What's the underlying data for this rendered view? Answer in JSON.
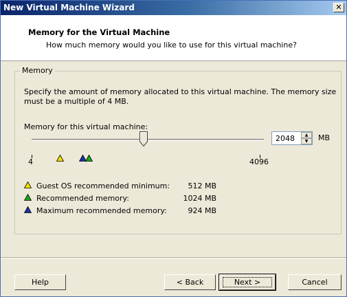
{
  "window": {
    "title": "New Virtual Machine Wizard",
    "close_glyph": "✕"
  },
  "header": {
    "title": "Memory for the Virtual Machine",
    "subtitle": "How much memory would you like to use for this virtual machine?"
  },
  "memory_group": {
    "label": "Memory",
    "description": "Specify the amount of memory allocated to this virtual machine. The memory size must be a multiple of 4 MB.",
    "field_label": "Memory for this virtual machine:",
    "slider": {
      "min_label": "4",
      "max_label": "4096",
      "current_mb": 2048
    },
    "spin_value": "2048",
    "unit": "MB",
    "legend": [
      {
        "icon": "yellow-triangle-icon",
        "color": "#f5e000",
        "label": "Guest OS recommended minimum:",
        "value": "512 MB"
      },
      {
        "icon": "green-triangle-icon",
        "color": "#1aa81a",
        "label": "Recommended memory:",
        "value": "1024 MB"
      },
      {
        "icon": "blue-triangle-icon",
        "color": "#1f2fa8",
        "label": "Maximum recommended memory:",
        "value": "924 MB"
      }
    ]
  },
  "buttons": {
    "help": "Help",
    "back": "< Back",
    "next": "Next >",
    "cancel": "Cancel"
  }
}
